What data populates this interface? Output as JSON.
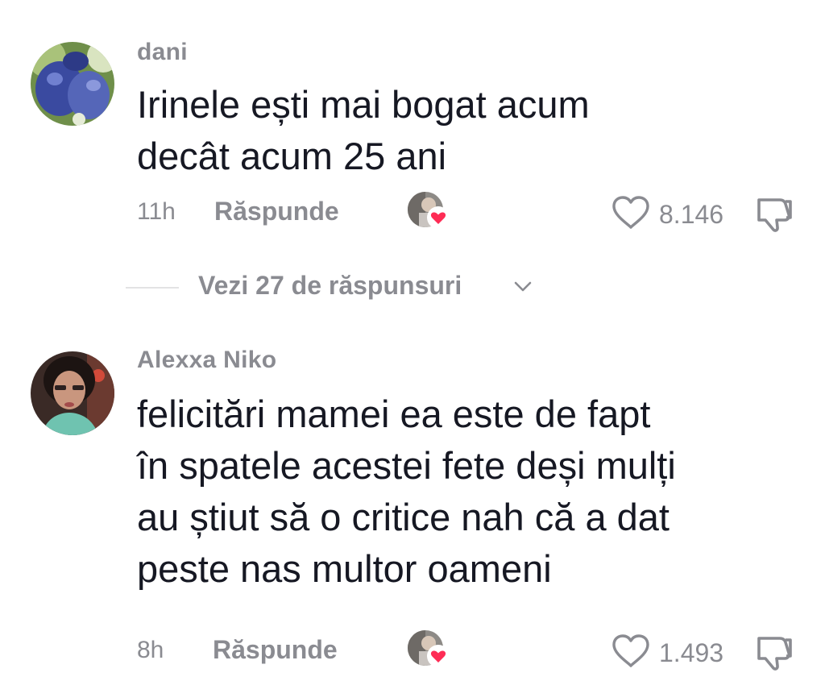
{
  "comments": [
    {
      "username": "dani",
      "text": "Irinele ești mai bogat acum\ndecât acum 25 ani",
      "time": "11h",
      "reply_label": "Răspunde",
      "likes": "8.146",
      "avatar_icon": "blue-bird-avatar"
    },
    {
      "username": "Alexxa Niko",
      "text": "felicitări mamei ea este de fapt\nîn spatele acestei fete deși mulți\nau știut să o critice nah că a dat\npeste nas multor oameni",
      "time": "8h",
      "reply_label": "Răspunde",
      "likes": "1.493",
      "avatar_icon": "woman-portrait-avatar"
    }
  ],
  "view_replies": {
    "label": "Vezi 27 de răspunsuri"
  },
  "colors": {
    "text_primary": "#161823",
    "text_secondary": "#8a8b91",
    "creator_heart": "#fe2c55"
  }
}
